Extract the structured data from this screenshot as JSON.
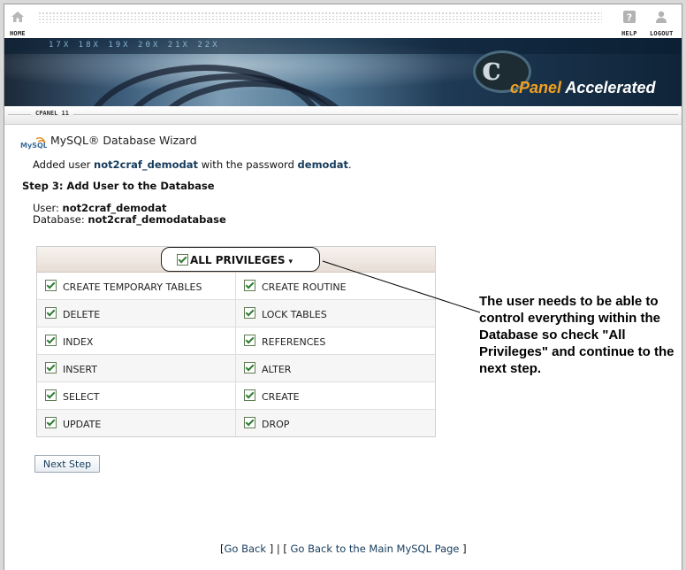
{
  "topbar": {
    "home_label": "HOME",
    "help_label": "HELP",
    "logout_label": "LOGOUT"
  },
  "banner": {
    "brand_word": "cPanel",
    "brand_suffix": "Accelerated",
    "numbers": "17X 18X 19X 20X 21X 22X"
  },
  "subbar": {
    "version_tag": "CPANEL 11"
  },
  "page": {
    "title": "MySQL® Database Wizard",
    "added_prefix": "Added user",
    "added_user": "not2craf_demodat",
    "added_middle": "with the password",
    "added_password": "demodat",
    "added_suffix": ".",
    "step_heading": "Step 3: Add User to the Database",
    "user_label": "User:",
    "user_value": "not2craf_demodat",
    "database_label": "Database:",
    "database_value": "not2craf_demodatabase"
  },
  "privileges": {
    "all_label": "ALL PRIVILEGES",
    "all_caret": "▾",
    "all_checked": true,
    "rows": [
      {
        "left": "CREATE TEMPORARY TABLES",
        "right": "CREATE ROUTINE"
      },
      {
        "left": "DELETE",
        "right": "LOCK TABLES"
      },
      {
        "left": "INDEX",
        "right": "REFERENCES"
      },
      {
        "left": "INSERT",
        "right": "ALTER"
      },
      {
        "left": "SELECT",
        "right": "CREATE"
      },
      {
        "left": "UPDATE",
        "right": "DROP"
      }
    ]
  },
  "annotation": "The user needs to be able to control everything within the Database so check \"All Privileges\" and continue to the next step.",
  "buttons": {
    "next_step": "Next Step"
  },
  "footer": {
    "open_bracket": "[",
    "go_back": "Go Back",
    "separator": "] | [",
    "main_mysql": "Go Back to the Main MySQL Page",
    "close_bracket": "]"
  },
  "colors": {
    "link": "#153b5c",
    "check_green": "#2e7d32",
    "brand_orange": "#f4a020"
  }
}
